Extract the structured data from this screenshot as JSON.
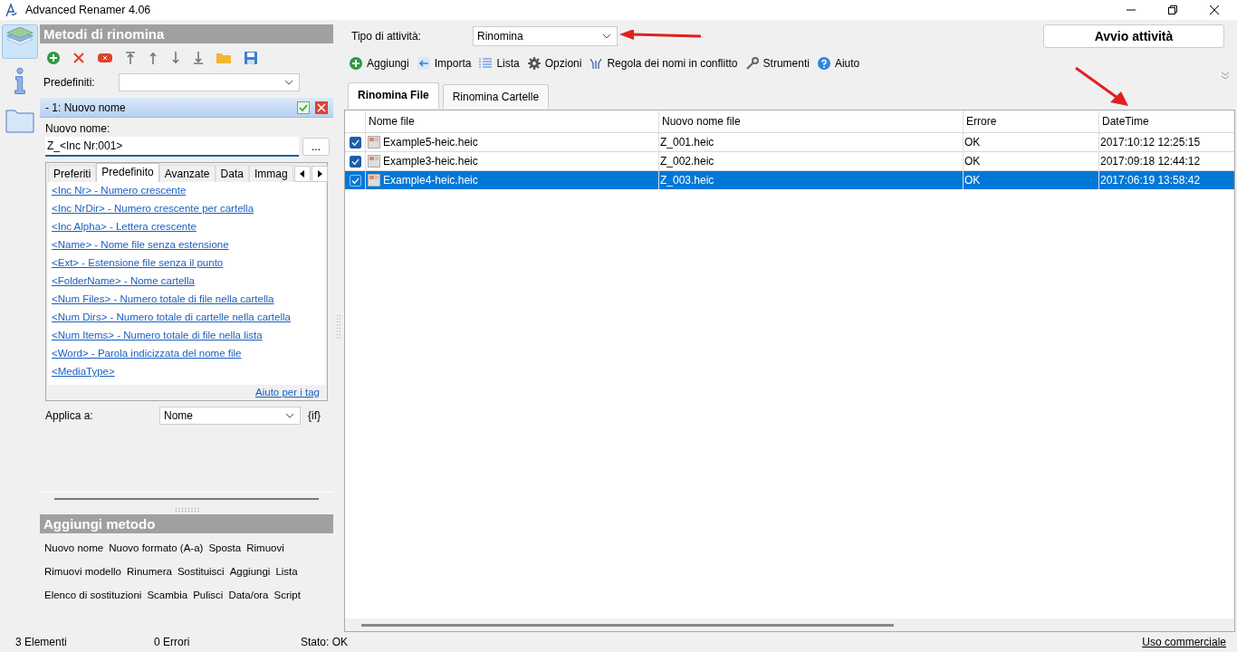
{
  "window": {
    "title": "Advanced Renamer 4.06"
  },
  "sidebar_icons": [
    {
      "kind": "layers",
      "selected": true
    },
    {
      "kind": "info",
      "selected": false
    },
    {
      "kind": "folder",
      "selected": false
    }
  ],
  "methods_panel": {
    "title": "Metodi di rinomina",
    "presets_label": "Predefiniti:",
    "method": {
      "label": "-  1: Nuovo nome",
      "enabled": true
    },
    "new_name_label": "Nuovo nome:",
    "new_name_value": "Z_<Inc Nr:001>",
    "browse_button": "...",
    "tag_tabs": [
      {
        "label": "Preferiti",
        "selected": false
      },
      {
        "label": "Predefinito",
        "selected": true
      },
      {
        "label": "Avanzate",
        "selected": false
      },
      {
        "label": "Data",
        "selected": false
      },
      {
        "label": "Immag",
        "selected": false
      }
    ],
    "tags": [
      "<Inc Nr>  - Numero crescente",
      "<Inc NrDir>  - Numero crescente per cartella",
      "<Inc Alpha>  - Lettera crescente",
      "<Name>  - Nome file senza estensione",
      "<Ext>  - Estensione file senza il punto",
      "<FolderName>  - Nome cartella",
      "<Num Files>  - Numero totale di file nella cartella",
      "<Num Dirs>  - Numero totale di cartelle nella cartella",
      "<Num Items>  - Numero totale di file nella lista",
      "<Word>  - Parola indicizzata del nome file",
      "<MediaType>"
    ],
    "tags_help_link": "Aiuto per i tag",
    "apply_label": "Applica a:",
    "apply_value": "Nome",
    "if_label": "{if}"
  },
  "add_method": {
    "title": "Aggiungi metodo",
    "rows": [
      [
        "Nuovo nome",
        "Nuovo formato (A-a)",
        "Sposta",
        "Rimuovi"
      ],
      [
        "Rimuovi modello",
        "Rinumera",
        "Sostituisci",
        "Aggiungi",
        "Lista"
      ],
      [
        "Elenco di sostituzioni",
        "Scambia",
        "Pulisci",
        "Data/ora",
        "Script"
      ]
    ]
  },
  "task": {
    "label": "Tipo di attività:",
    "value": "Rinomina",
    "start_button": "Avvio attività"
  },
  "toolbar": [
    {
      "kind": "add",
      "label": "Aggiungi"
    },
    {
      "kind": "import",
      "label": "Importa"
    },
    {
      "kind": "list",
      "label": "Lista"
    },
    {
      "kind": "options",
      "label": "Opzioni"
    },
    {
      "kind": "conflict",
      "label": "Regola dei nomi in conflitto"
    },
    {
      "kind": "tools",
      "label": "Strumenti"
    },
    {
      "kind": "help",
      "label": "Aiuto"
    }
  ],
  "file_tabs": [
    {
      "label": "Rinomina File",
      "selected": true
    },
    {
      "label": "Rinomina Cartelle",
      "selected": false
    }
  ],
  "table": {
    "columns": [
      "Nome file",
      "Nuovo nome file",
      "Errore",
      "DateTime"
    ],
    "rows": [
      {
        "checked": true,
        "selected": false,
        "cells": [
          "Example5-heic.heic",
          "Z_001.heic",
          "OK",
          "2017:10:12 12:25:15"
        ]
      },
      {
        "checked": true,
        "selected": false,
        "cells": [
          "Example3-heic.heic",
          "Z_002.heic",
          "OK",
          "2017:09:18 12:44:12"
        ]
      },
      {
        "checked": true,
        "selected": true,
        "cells": [
          "Example4-heic.heic",
          "Z_003.heic",
          "OK",
          "2017:06:19 13:58:42"
        ]
      }
    ]
  },
  "status_bar": {
    "items": [
      "3 Elementi",
      "0 Errori",
      "Stato: OK"
    ],
    "link": "Uso commerciale"
  }
}
